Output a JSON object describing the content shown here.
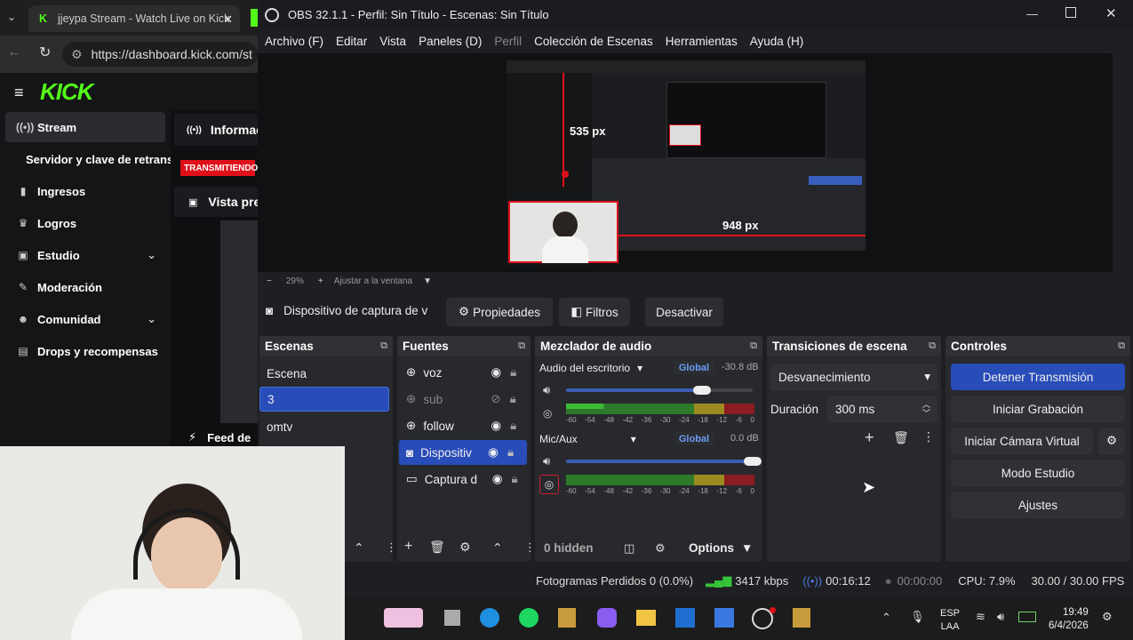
{
  "browser": {
    "tab_title": "jjeypa Stream - Watch Live on Kick",
    "url": "https://dashboard.kick.com/st"
  },
  "kick": {
    "logo": "KICK",
    "nav": [
      {
        "label": "Stream",
        "icon": "broadcast-icon"
      },
      {
        "label": "Servidor y clave de retransn",
        "icon": ""
      },
      {
        "label": "Ingresos",
        "icon": "chart-icon"
      },
      {
        "label": "Logros",
        "icon": "trophy-icon"
      },
      {
        "label": "Estudio",
        "icon": "tv-icon"
      },
      {
        "label": "Moderación",
        "icon": "wrench-icon"
      },
      {
        "label": "Comunidad",
        "icon": "people-icon"
      },
      {
        "label": "Drops y recompensas",
        "icon": "gift-icon"
      }
    ],
    "main": {
      "info_title": "Informac",
      "live_badge": "TRANSMITIENDO",
      "preview_title": "Vista pre",
      "feed_title": "Feed de"
    }
  },
  "obs": {
    "title": "OBS 32.1.1 - Perfil: Sin Título - Escenas: Sin Título",
    "menu": [
      "Archivo (F)",
      "Editar",
      "Vista",
      "Paneles (D)",
      "Perfil",
      "Colección de Escenas",
      "Herramientas",
      "Ayuda (H)"
    ],
    "preview_overlay": {
      "height_label": "535 px",
      "width_label": "948 px"
    },
    "zoom": {
      "level": "29%",
      "fit_label": "Ajustar a la ventana"
    },
    "source_bar": {
      "source_name": "Dispositivo de captura de v",
      "properties": "Propiedades",
      "filters": "Filtros",
      "deactivate": "Desactivar"
    },
    "scenes": {
      "title": "Escenas",
      "items": [
        "Escena",
        "3",
        "omtv"
      ],
      "selected": "3"
    },
    "sources": {
      "title": "Fuentes",
      "items": [
        {
          "name": "voz",
          "icon": "globe-icon",
          "visible": true
        },
        {
          "name": "sub",
          "icon": "globe-icon",
          "visible": false
        },
        {
          "name": "follow",
          "icon": "globe-icon",
          "visible": true
        },
        {
          "name": "Dispositiv",
          "icon": "camera-icon",
          "visible": true
        },
        {
          "name": "Captura d",
          "icon": "monitor-icon",
          "visible": true
        }
      ]
    },
    "mixer": {
      "title": "Mezclador de audio",
      "channels": [
        {
          "name": "Audio del escritorio",
          "badge": "Global",
          "db": "-30.8 dB",
          "volume": 0.73
        },
        {
          "name": "Mic/Aux",
          "badge": "Global",
          "db": "0.0 dB",
          "volume": 1.0
        }
      ],
      "ticks": [
        "-60",
        "-54",
        "-48",
        "-42",
        "-36",
        "-30",
        "-24",
        "-18",
        "-12",
        "-6",
        "0"
      ],
      "hidden": "0 hidden",
      "options": "Options"
    },
    "transitions": {
      "title": "Transiciones de escena",
      "type": "Desvanecimiento",
      "duration_label": "Duración",
      "duration_value": "300 ms"
    },
    "controls": {
      "title": "Controles",
      "stop_stream": "Detener Transmisión",
      "start_record": "Iniciar Grabación",
      "start_vcam": "Iniciar Cámara Virtual",
      "studio_mode": "Modo Estudio",
      "settings": "Ajustes"
    },
    "status": {
      "dropped": "Fotogramas Perdidos 0 (0.0%)",
      "bitrate": "3417 kbps",
      "live_time": "00:16:12",
      "rec_time": "00:00:00",
      "cpu": "CPU: 7.9%",
      "fps": "30.00 / 30.00 FPS"
    }
  },
  "taskbar": {
    "lang": "ESP",
    "layout": "LAA",
    "time": "19:49",
    "date": "6/4/2026"
  },
  "colors": {
    "accent": "#3a5ebf",
    "kick_green": "#53fc18",
    "live_red": "#e0101a"
  }
}
